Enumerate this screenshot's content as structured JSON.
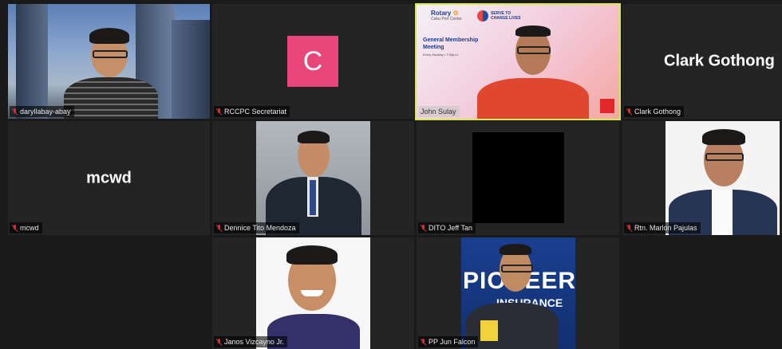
{
  "participants": [
    {
      "name": "daryllabay-abay"
    },
    {
      "name": "RCCPC Secretariat",
      "avatar_letter": "C",
      "avatar_color": "#e8457a"
    },
    {
      "name": "John Sulay",
      "banner": {
        "org": "Rotary",
        "club": "Cebu Port Center",
        "slogan_line1": "SERVE TO",
        "slogan_line2": "CHANGE LIVES",
        "title_line1": "General Membership",
        "title_line2": "Meeting",
        "subtitle": "Every Monday • 7:30p.m."
      }
    },
    {
      "name": "Clark Gothong",
      "display": "Clark Gothong"
    },
    {
      "name": "mcwd",
      "display": "mcwd"
    },
    {
      "name": "Dennice Tito Mendoza"
    },
    {
      "name": "DITO Jeff Tan"
    },
    {
      "name": "Rtn. Marlon Pajulas"
    },
    {
      "name": "Janos Vizcayno Jr."
    },
    {
      "name": "PP Jun Falcon",
      "backdrop_text1": "PIONEER",
      "backdrop_text2": "INSURANCE"
    }
  ],
  "colors": {
    "active_border": "#d6e84a",
    "muted_mic": "#e02828"
  }
}
